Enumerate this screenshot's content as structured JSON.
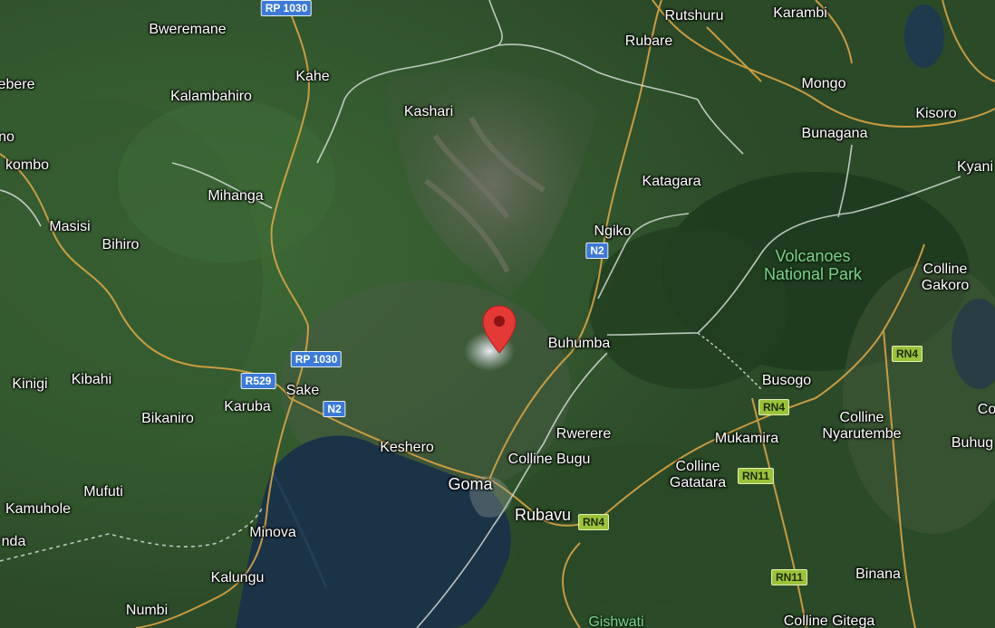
{
  "map": {
    "colors": {
      "forest_dark": "#1f3a1e",
      "forest": "#2f4f2b",
      "lake": "#1b3347",
      "lava": "#5f6155",
      "road": "#d9a443",
      "border": "#d6ded8",
      "pin": "#e53935",
      "pin_dot": "#8b1313",
      "park_label": "#7ed08c"
    },
    "places": {
      "bweremane": "Bweremane",
      "ebere": "ebere",
      "kalambahiro": "Kalambahiro",
      "kahe": "Kahe",
      "kashari": "Kashari",
      "rutshuru": "Rutshuru",
      "karambi": "Karambi",
      "rubare": "Rubare",
      "mongo": "Mongo",
      "kisoro": "Kisoro",
      "bunagana": "Bunagana",
      "no": "no",
      "kombo": "kombo",
      "mihanga": "Mihanga",
      "katagara": "Katagara",
      "kyani": "Kyani",
      "masisi": "Masisi",
      "bihiro": "Bihiro",
      "ngiko": "Ngiko",
      "colline_gakoro": "Colline\nGakoro",
      "buhumba": "Buhumba",
      "kinigi": "Kinigi",
      "kibahi": "Kibahi",
      "sake": "Sake",
      "karuba": "Karuba",
      "busogo": "Busogo",
      "bikaniro": "Bikaniro",
      "rwerere": "Rwerere",
      "colline_nyarutembe": "Colline\nNyarutembe",
      "co": "Co",
      "keshero": "Keshero",
      "mukamira": "Mukamira",
      "buhug": "Buhug",
      "colline_bugu": "Colline Bugu",
      "goma": "Goma",
      "colline_gatatara": "Colline\nGatatara",
      "mufuti": "Mufuti",
      "kamuhole": "Kamuhole",
      "rubavu": "Rubavu",
      "minova": "Minova",
      "nda": "nda",
      "kalungu": "Kalungu",
      "binana": "Binana",
      "numbi": "Numbi",
      "gishwati": "Gishwati",
      "colline_gitega": "Colline Gitega"
    },
    "park": "Volcanoes\nNational Park",
    "shields": {
      "rp1030_top": "RP 1030",
      "n2_ngiko": "N2",
      "rp1030_sake": "RP 1030",
      "r529": "R529",
      "n2_sake": "N2",
      "rn4_east": "RN4",
      "rn4_busogo": "RN4",
      "rn11_mukamira": "RN11",
      "rn4_rubavu": "RN4",
      "rn11_south": "RN11"
    },
    "marker": "volcano-location-pin"
  }
}
